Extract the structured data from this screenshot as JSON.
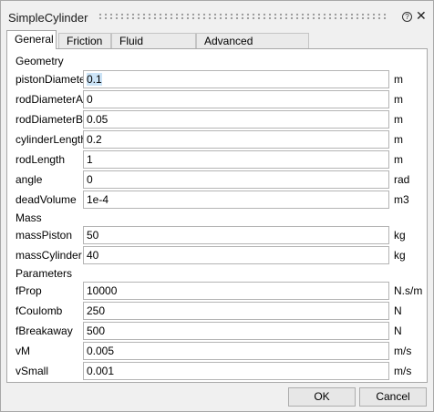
{
  "window": {
    "title": "SimpleCylinder",
    "help_icon": "?",
    "close_icon": "✕"
  },
  "tabs": [
    {
      "label": "General",
      "active": true
    },
    {
      "label": "Friction",
      "active": false
    },
    {
      "label": "Fluid Properties",
      "active": false
    },
    {
      "label": "Advanced Initialization",
      "active": false
    }
  ],
  "sections": {
    "geometry": "Geometry",
    "mass": "Mass",
    "parameters": "Parameters"
  },
  "fields": {
    "pistonDiameter": {
      "label": "pistonDiameter",
      "value": "0.1",
      "unit": "m"
    },
    "rodDiameterA": {
      "label": "rodDiameterA",
      "value": "0",
      "unit": "m"
    },
    "rodDiameterB": {
      "label": "rodDiameterB",
      "value": "0.05",
      "unit": "m"
    },
    "cylinderLength": {
      "label": "cylinderLength",
      "value": "0.2",
      "unit": "m"
    },
    "rodLength": {
      "label": "rodLength",
      "value": "1",
      "unit": "m"
    },
    "angle": {
      "label": "angle",
      "value": "0",
      "unit": "rad"
    },
    "deadVolume": {
      "label": "deadVolume",
      "value": "1e-4",
      "unit": "m3"
    },
    "massPiston": {
      "label": "massPiston",
      "value": "50",
      "unit": "kg"
    },
    "massCylinder": {
      "label": "massCylinder",
      "value": "40",
      "unit": "kg"
    },
    "fProp": {
      "label": "fProp",
      "value": "10000",
      "unit": "N.s/m"
    },
    "fCoulomb": {
      "label": "fCoulomb",
      "value": "250",
      "unit": "N"
    },
    "fBreakaway": {
      "label": "fBreakaway",
      "value": "500",
      "unit": "N"
    },
    "vM": {
      "label": "vM",
      "value": "0.005",
      "unit": "m/s"
    },
    "vSmall": {
      "label": "vSmall",
      "value": "0.001",
      "unit": "m/s"
    }
  },
  "buttons": {
    "ok": "OK",
    "cancel": "Cancel"
  }
}
